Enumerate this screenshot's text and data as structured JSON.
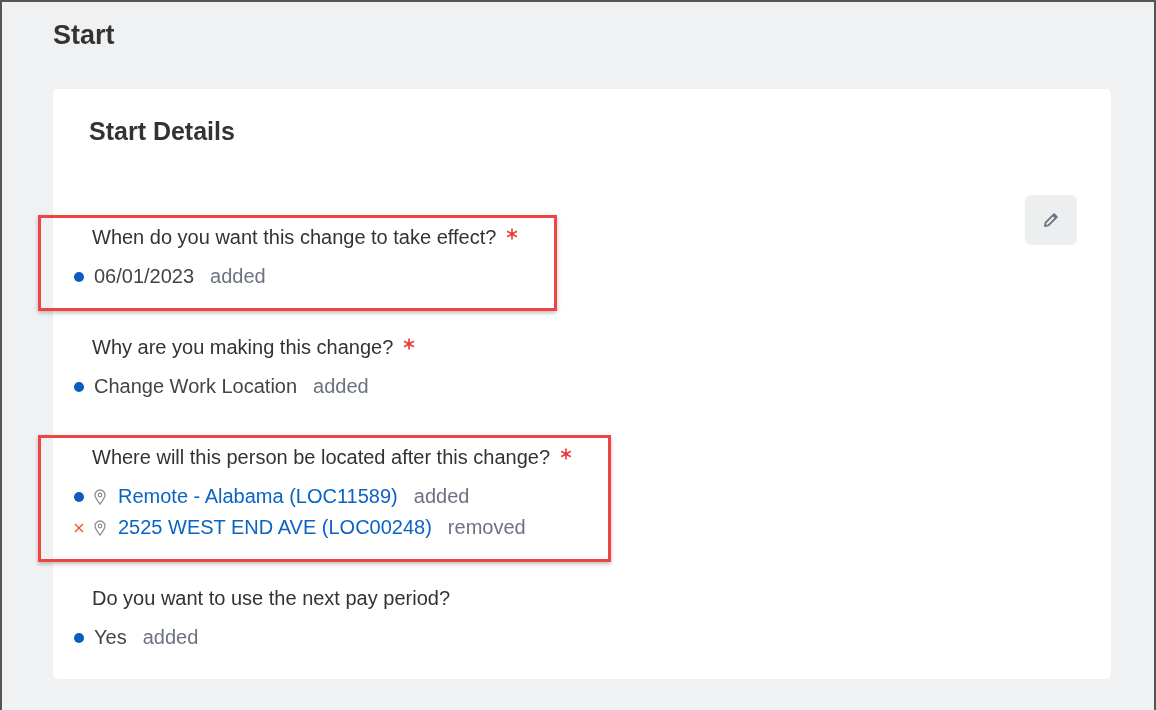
{
  "page": {
    "title": "Start"
  },
  "card": {
    "title": "Start Details"
  },
  "questions": [
    {
      "label": "When do you want this change to take effect?",
      "required": true,
      "highlighted": true,
      "values": [
        {
          "kind": "added",
          "location": false,
          "text": "06/01/2023",
          "status": "added"
        }
      ]
    },
    {
      "label": "Why are you making this change?",
      "required": true,
      "highlighted": false,
      "values": [
        {
          "kind": "added",
          "location": false,
          "text": "Change Work Location",
          "status": "added"
        }
      ]
    },
    {
      "label": "Where will this person be located after this change?",
      "required": true,
      "highlighted": true,
      "values": [
        {
          "kind": "added",
          "location": true,
          "text": "Remote - Alabama (LOC11589)",
          "status": "added"
        },
        {
          "kind": "removed",
          "location": true,
          "text": "2525 WEST END AVE (LOC00248)",
          "status": "removed"
        }
      ]
    },
    {
      "label": "Do you want to use the next pay period?",
      "required": false,
      "highlighted": false,
      "values": [
        {
          "kind": "added",
          "location": false,
          "text": "Yes",
          "status": "added"
        }
      ]
    }
  ]
}
